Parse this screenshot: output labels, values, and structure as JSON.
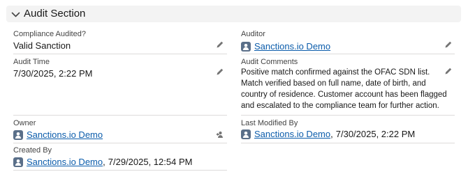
{
  "section": {
    "title": "Audit Section"
  },
  "fields": {
    "compliance_audited": {
      "label": "Compliance Audited?",
      "value": "Valid Sanction"
    },
    "auditor": {
      "label": "Auditor",
      "user": "Sanctions.io Demo"
    },
    "audit_time": {
      "label": "Audit Time",
      "value": "7/30/2025, 2:22 PM"
    },
    "audit_comments": {
      "label": "Audit Comments",
      "lines": [
        "Positive match confirmed against the OFAC SDN list.",
        "Match verified based on full name, date of birth, and",
        "country of residence. Customer account has been flagged",
        "and escalated to the compliance team for further action."
      ]
    },
    "owner": {
      "label": "Owner",
      "user": "Sanctions.io Demo"
    },
    "last_modified_by": {
      "label": "Last Modified By",
      "user": "Sanctions.io Demo",
      "date": "7/30/2025, 2:22 PM"
    },
    "created_by": {
      "label": "Created By",
      "user": "Sanctions.io Demo",
      "date": "7/29/2025, 12:54 PM"
    }
  },
  "separator": ",",
  "icons": {
    "chevron": "chevron-down-icon",
    "edit": "pencil-icon",
    "change_owner": "change-owner-icon",
    "user_avatar": "user-avatar-icon"
  },
  "colors": {
    "link": "#0b5cab",
    "header_bg": "#f3f3f3",
    "divider": "#dddbda",
    "label": "#444444",
    "icon": "#747474"
  }
}
